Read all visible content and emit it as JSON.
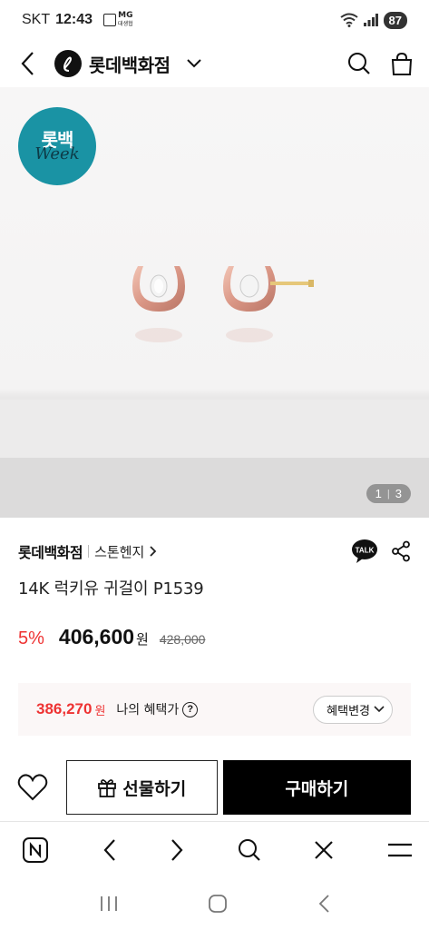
{
  "status_bar": {
    "carrier": "SKT",
    "time": "12:43",
    "mg_label": "MG",
    "mg_sub": "대생협",
    "battery": "87"
  },
  "header": {
    "brand_name": "롯데백화점"
  },
  "hero": {
    "badge_kr": "롯백",
    "badge_en": "Week",
    "page_current": "1",
    "page_total": "3"
  },
  "product": {
    "seller": "롯데백화점",
    "brand": "스톤헨지",
    "title": "14K 럭키유 귀걸이 P1539",
    "discount": "5%",
    "price": "406,600",
    "won": "원",
    "original_price": "428,000"
  },
  "benefit": {
    "price": "386,270",
    "won": "원",
    "label": "나의 혜택가",
    "help": "?",
    "change_label": "혜택변경"
  },
  "actions": {
    "gift_label": "선물하기",
    "buy_label": "구매하기"
  },
  "colors": {
    "accent_red": "#e33333",
    "badge_teal": "#1a93a4",
    "buy_black": "#000000"
  }
}
